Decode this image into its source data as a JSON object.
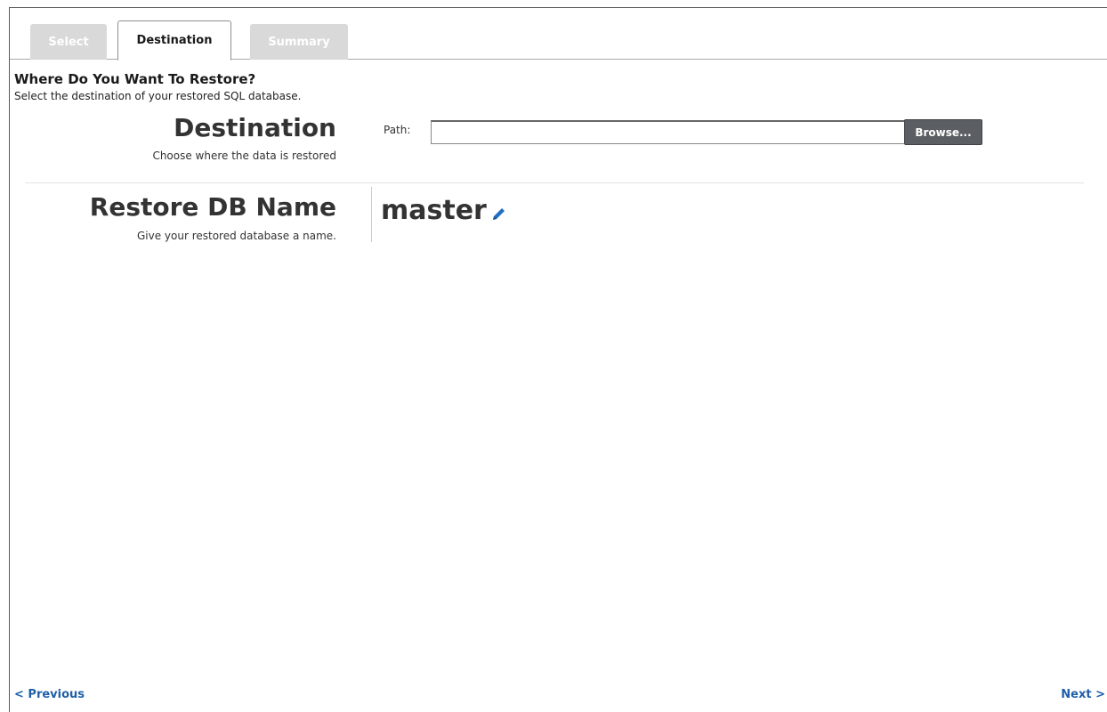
{
  "tabs": [
    {
      "label": "Select",
      "state": "inactive"
    },
    {
      "label": "Destination",
      "state": "active"
    },
    {
      "label": "Summary",
      "state": "inactive"
    }
  ],
  "header": {
    "title": "Where Do You Want To Restore?",
    "subtitle": "Select the destination of your restored SQL database."
  },
  "destination": {
    "title": "Destination",
    "description": "Choose where the data is restored",
    "path_label": "Path:",
    "path_value": "",
    "browse_label": "Browse..."
  },
  "restore_db": {
    "title": "Restore DB Name",
    "description": "Give your restored database a name.",
    "name_value": "master",
    "edit_icon": "pencil-icon"
  },
  "nav": {
    "previous_label": "< Previous",
    "next_label": "Next >"
  },
  "colors": {
    "link": "#1f5fa8",
    "button_bg": "#5b5f63",
    "inactive_tab": "#d9d9d9",
    "pencil": "#1f6fc4"
  }
}
